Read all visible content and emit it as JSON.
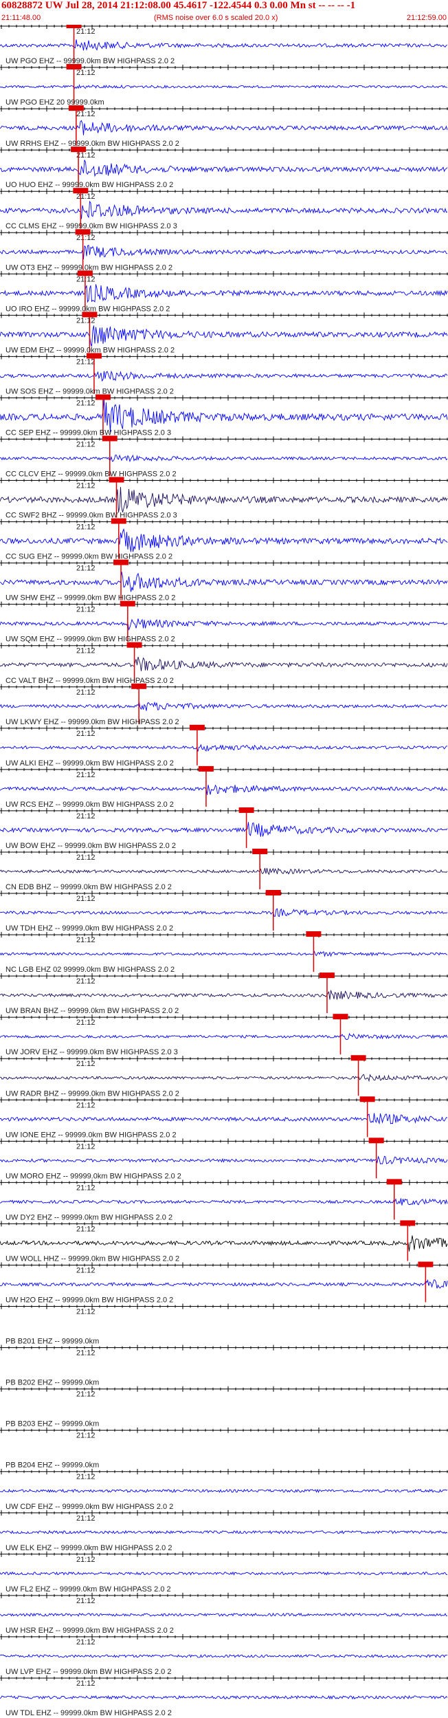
{
  "header": {
    "title": "60828872 UW Jul 28, 2014 21:12:08.00   45.4617 -122.4544  0.3 0.00 Mn st -- -- --  -1",
    "start_time": "21:11:48.00",
    "note": "(RMS noise over 6.0 s scaled 20.0 x)",
    "end_time": "21:12:59.00"
  },
  "colors": {
    "trace_blue": "#0000ff",
    "trace_dark": "#1a0a5a",
    "trace_black": "#000000",
    "pick_red": "#e00000",
    "axis": "#000000"
  },
  "time_mark": "21:12",
  "traces": [
    {
      "label": "UW PGO EHZ -- 99999.0km BW  HIGHPASS  2.0  2",
      "amp": 0.5,
      "color": "blue",
      "pick": 0.165
    },
    {
      "label": "UW PGO EHZ 20 99999.0km",
      "amp": 0.1,
      "color": "blue",
      "pick": 0.165
    },
    {
      "label": "UW RRHS EHZ -- 99999.0km BW  HIGHPASS  2.0  2",
      "amp": 0.7,
      "color": "blue",
      "pick": 0.17
    },
    {
      "label": "UO HUO EHZ -- 99999.0km BW  HIGHPASS  2.0  2",
      "amp": 0.9,
      "color": "blue",
      "pick": 0.175
    },
    {
      "label": "CC CLMS EHZ -- 99999.0km BW  HIGHPASS  2.0  3",
      "amp": 1.0,
      "color": "blue",
      "pick": 0.18
    },
    {
      "label": "UW OT3 EHZ -- 99999.0km BW  HIGHPASS  2.0  2",
      "amp": 0.6,
      "color": "blue",
      "pick": 0.185
    },
    {
      "label": "UO IRO EHZ -- 99999.0km BW  HIGHPASS  2.0  2",
      "amp": 0.9,
      "color": "blue",
      "pick": 0.19
    },
    {
      "label": "UW EDM EHZ -- 99999.0km BW  HIGHPASS  2.0  2",
      "amp": 1.1,
      "color": "blue",
      "pick": 0.2
    },
    {
      "label": "UW SOS EHZ -- 99999.0km BW  HIGHPASS  2.0  2",
      "amp": 0.5,
      "color": "blue",
      "pick": 0.21
    },
    {
      "label": "CC SEP EHZ -- 99999.0km BW  HIGHPASS  2.0  3",
      "amp": 1.6,
      "color": "blue",
      "pick": 0.23
    },
    {
      "label": "CC CLCV EHZ -- 99999.0km BW  HIGHPASS  2.0  2",
      "amp": 0.3,
      "color": "blue",
      "pick": 0.245
    },
    {
      "label": "CC SWF2 BHZ -- 99999.0km BW  HIGHPASS  2.0  3",
      "amp": 1.3,
      "color": "dark",
      "pick": 0.26
    },
    {
      "label": "CC SUG EHZ -- 99999.0km BW  HIGHPASS  2.0  2",
      "amp": 1.2,
      "color": "blue",
      "pick": 0.265
    },
    {
      "label": "UW SHW EHZ -- 99999.0km BW  HIGHPASS  2.0  2",
      "amp": 1.0,
      "color": "blue",
      "pick": 0.27
    },
    {
      "label": "UW SQM EHZ -- 99999.0km BW  HIGHPASS  2.0  2",
      "amp": 0.5,
      "color": "blue",
      "pick": 0.285
    },
    {
      "label": "CC VALT BHZ -- 99999.0km BW  HIGHPASS  2.0  2",
      "amp": 0.7,
      "color": "dark",
      "pick": 0.3
    },
    {
      "label": "UW LKWY EHZ -- 99999.0km BW  HIGHPASS  2.0  2",
      "amp": 0.4,
      "color": "blue",
      "pick": 0.31
    },
    {
      "label": "UW ALKI EHZ -- 99999.0km BW  HIGHPASS  2.0  2",
      "amp": 0.3,
      "color": "blue",
      "pick": 0.44
    },
    {
      "label": "UW RCS EHZ -- 99999.0km BW  HIGHPASS  2.0  2",
      "amp": 0.5,
      "color": "blue",
      "pick": 0.46
    },
    {
      "label": "UW BOW EHZ -- 99999.0km BW  HIGHPASS  2.0  2",
      "amp": 0.7,
      "color": "blue",
      "pick": 0.55
    },
    {
      "label": "CN EDB BHZ -- 99999.0km BW  HIGHPASS  2.0  2",
      "amp": 0.25,
      "color": "dark",
      "pick": 0.58
    },
    {
      "label": "UW TDH EHZ -- 99999.0km BW  HIGHPASS  2.0  2",
      "amp": 0.3,
      "color": "blue",
      "pick": 0.61
    },
    {
      "label": "NC LGB EHZ 02 99999.0km BW  HIGHPASS  2.0  2",
      "amp": 0.15,
      "color": "blue",
      "pick": 0.7
    },
    {
      "label": "UW BRAN BHZ -- 99999.0km BW  HIGHPASS  2.0  2",
      "amp": 0.4,
      "color": "dark",
      "pick": 0.73
    },
    {
      "label": "UW JORV EHZ -- 99999.0km BW  HIGHPASS  2.0  3",
      "amp": 0.2,
      "color": "blue",
      "pick": 0.76
    },
    {
      "label": "UW RADR BHZ -- 99999.0km BW  HIGHPASS  2.0  2",
      "amp": 0.25,
      "color": "dark",
      "pick": 0.8
    },
    {
      "label": "UW IONE EHZ -- 99999.0km BW  HIGHPASS  2.0  2",
      "amp": 0.6,
      "color": "blue",
      "pick": 0.82
    },
    {
      "label": "UW MORO EHZ -- 99999.0km BW  HIGHPASS  2.0  2",
      "amp": 0.35,
      "color": "blue",
      "pick": 0.84
    },
    {
      "label": "UW DY2 EHZ -- 99999.0km BW  HIGHPASS  2.0  2",
      "amp": 0.3,
      "color": "blue",
      "pick": 0.88
    },
    {
      "label": "UW WOLL HHZ -- 99999.0km BW  HIGHPASS  2.0  2",
      "amp": 0.7,
      "color": "black",
      "pick": 0.91
    },
    {
      "label": "UW H2O EHZ -- 99999.0km BW  HIGHPASS  2.0  2",
      "amp": 0.4,
      "color": "blue",
      "pick": 0.95
    },
    {
      "label": "PB B201 EHZ -- 99999.0km",
      "amp": 0.0,
      "color": "blue",
      "pick": null
    },
    {
      "label": "PB B202 EHZ -- 99999.0km",
      "amp": 0.0,
      "color": "blue",
      "pick": null
    },
    {
      "label": "PB B203 EHZ -- 99999.0km",
      "amp": 0.0,
      "color": "blue",
      "pick": null
    },
    {
      "label": "PB B204 EHZ -- 99999.0km",
      "amp": 0.0,
      "color": "blue",
      "pick": null
    },
    {
      "label": "UW CDF EHZ -- 99999.0km BW  HIGHPASS  2.0  2",
      "amp": 0.25,
      "color": "blue",
      "pick": null
    },
    {
      "label": "UW ELK EHZ -- 99999.0km BW  HIGHPASS  2.0  2",
      "amp": 0.25,
      "color": "blue",
      "pick": null
    },
    {
      "label": "UW FL2 EHZ -- 99999.0km BW  HIGHPASS  2.0  2",
      "amp": 0.25,
      "color": "blue",
      "pick": null
    },
    {
      "label": "UW HSR EHZ -- 99999.0km BW  HIGHPASS  2.0  2",
      "amp": 0.25,
      "color": "blue",
      "pick": null
    },
    {
      "label": "UW LVP EHZ -- 99999.0km BW  HIGHPASS  2.0  2",
      "amp": 0.25,
      "color": "blue",
      "pick": null
    },
    {
      "label": "UW TDL EHZ -- 99999.0km BW  HIGHPASS  2.0  2",
      "amp": 0.3,
      "color": "blue",
      "pick": null
    }
  ]
}
